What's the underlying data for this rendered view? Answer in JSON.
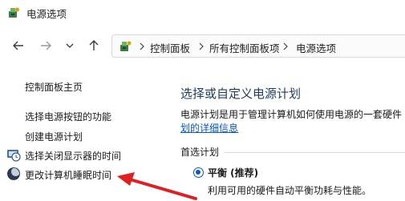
{
  "window": {
    "title": "电源选项"
  },
  "address": {
    "breadcrumbs": [
      "控制面板",
      "所有控制面板项",
      "电源选项"
    ]
  },
  "sidebar": {
    "items": [
      {
        "label": "控制面板主页",
        "icon": null
      },
      {
        "label": "选择电源按钮的功能",
        "icon": null
      },
      {
        "label": "创建电源计划",
        "icon": null
      },
      {
        "label": "选择关闭显示器的时间",
        "icon": "clock-icon"
      },
      {
        "label": "更改计算机睡眠时间",
        "icon": "moon-icon"
      }
    ]
  },
  "main": {
    "title": "选择或自定义电源计划",
    "description": "电源计划是用于管理计算机如何使用电源的一套硬件",
    "description_link": "划的详细信息",
    "group_label": "首选计划",
    "plan": {
      "name": "平衡 (推荐)",
      "description": "利用可用的硬件自动平衡功耗与性能。",
      "selected": true
    }
  },
  "colors": {
    "title_blue": "#1e3a5f",
    "link_blue": "#0b57c2",
    "annotation_red": "#e02020"
  }
}
